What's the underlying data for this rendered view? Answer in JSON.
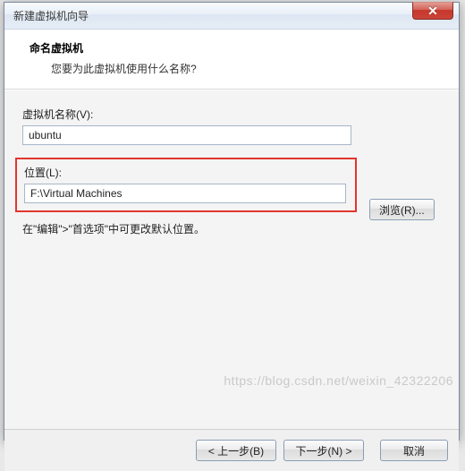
{
  "window": {
    "title": "新建虚拟机向导",
    "close_icon": "✕"
  },
  "header": {
    "title": "命名虚拟机",
    "subtitle": "您要为此虚拟机使用什么名称?"
  },
  "fields": {
    "name_label": "虚拟机名称(V):",
    "name_value": "ubuntu",
    "location_label": "位置(L):",
    "location_value": "F:\\Virtual Machines",
    "browse_label": "浏览(R)..."
  },
  "hint": "在\"编辑\">\"首选项\"中可更改默认位置。",
  "buttons": {
    "back": "< 上一步(B)",
    "next": "下一步(N) >",
    "cancel": "取消"
  },
  "watermark": "https://blog.csdn.net/weixin_42322206"
}
